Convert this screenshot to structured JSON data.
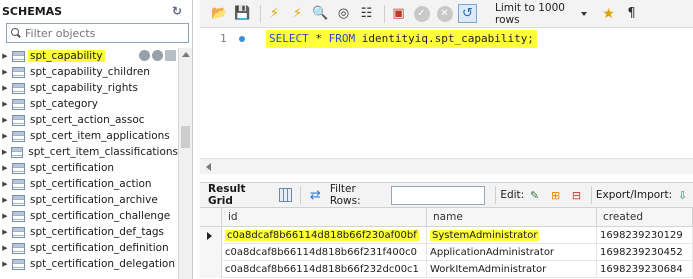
{
  "schemas": {
    "title": "SCHEMAS",
    "filter_placeholder": "Filter objects",
    "items": [
      {
        "label": "spt_capability",
        "selected": true
      },
      {
        "label": "spt_capability_children"
      },
      {
        "label": "spt_capability_rights"
      },
      {
        "label": "spt_category"
      },
      {
        "label": "spt_cert_action_assoc"
      },
      {
        "label": "spt_cert_item_applications"
      },
      {
        "label": "spt_cert_item_classifications"
      },
      {
        "label": "spt_certification"
      },
      {
        "label": "spt_certification_action"
      },
      {
        "label": "spt_certification_archive"
      },
      {
        "label": "spt_certification_challenge"
      },
      {
        "label": "spt_certification_def_tags"
      },
      {
        "label": "spt_certification_definition"
      },
      {
        "label": "spt_certification_delegation"
      }
    ]
  },
  "toolbar": {
    "limit_label": "Limit to 1000 rows"
  },
  "editor": {
    "line_number": "1",
    "kw_select": "SELECT",
    "star": " * ",
    "kw_from": "FROM",
    "rest": " identityiq.spt_capability;"
  },
  "results": {
    "grid_label": "Result Grid",
    "filter_label": "Filter Rows:",
    "edit_label": "Edit:",
    "export_label": "Export/Import:",
    "columns": [
      "id",
      "name",
      "created"
    ],
    "rows": [
      {
        "id": "c0a8dcaf8b66114d818b66f230af00bf",
        "name": "SystemAdministrator",
        "created": "1698239230129"
      },
      {
        "id": "c0a8dcaf8b66114d818b66f231f400c0",
        "name": "ApplicationAdministrator",
        "created": "1698239230452"
      },
      {
        "id": "c0a8dcaf8b66114d818b66f232dc00c1",
        "name": "WorkItemAdministrator",
        "created": "1698239230684"
      }
    ]
  },
  "colors": {
    "highlight": "#ffff3a",
    "keyword": "#1f4fc4"
  }
}
